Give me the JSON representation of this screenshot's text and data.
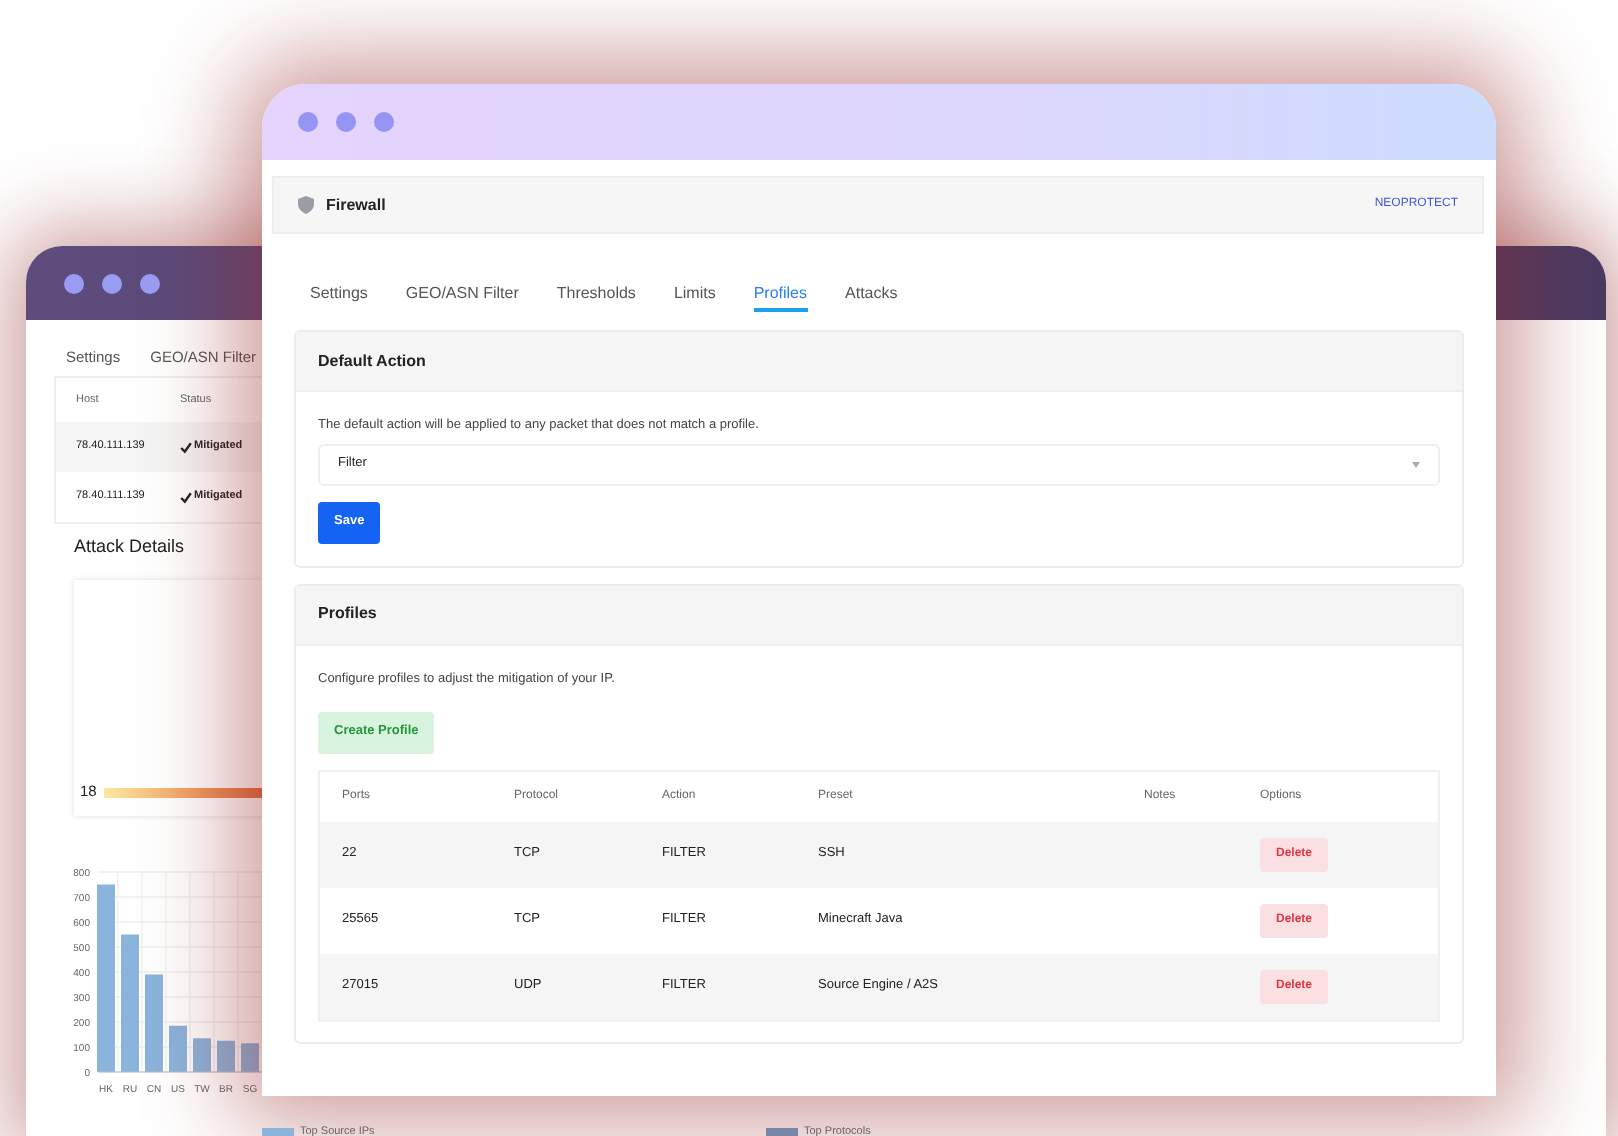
{
  "back_window": {
    "tabs": [
      {
        "label": "Settings",
        "selected": false
      },
      {
        "label": "GEO/ASN Filter",
        "selected": false
      }
    ],
    "attacks_table": {
      "columns": [
        "Host",
        "Status"
      ],
      "rows": [
        {
          "host": "78.40.111.139",
          "status": "Mitigated"
        },
        {
          "host": "78.40.111.139",
          "status": "Mitigated"
        }
      ]
    },
    "attack_details": {
      "title": "Attack Details",
      "scale_label": "18",
      "chart_data": {
        "type": "bar",
        "grid": true,
        "categories": [
          "HK",
          "RU",
          "CN",
          "US",
          "TW",
          "BR",
          "SG"
        ],
        "series": [
          {
            "name": "Top Source IPs",
            "color": "#8ab4dc",
            "values": [
              750,
              550,
              390,
              185,
              135,
              125,
              115
            ]
          }
        ],
        "ylim": [
          0,
          800
        ],
        "yticks": [
          0,
          100,
          200,
          300,
          400,
          500,
          600,
          700,
          800
        ]
      }
    },
    "legends": [
      {
        "label": "Top Protocols",
        "color": "#7a86a8"
      }
    ]
  },
  "front_window": {
    "header": {
      "title": "Firewall",
      "brand": "NEOPROTECT"
    },
    "tabs": [
      {
        "label": "Settings",
        "selected": false
      },
      {
        "label": "GEO/ASN Filter",
        "selected": false
      },
      {
        "label": "Thresholds",
        "selected": false
      },
      {
        "label": "Limits",
        "selected": false
      },
      {
        "label": "Profiles",
        "selected": true
      },
      {
        "label": "Attacks",
        "selected": false
      }
    ],
    "default_action": {
      "title": "Default Action",
      "description": "The default action will be applied to any packet that does not match a profile.",
      "value": "Filter",
      "button": "Save"
    },
    "profiles": {
      "title": "Profiles",
      "description": "Configure profiles to adjust the mitigation of your IP.",
      "button": "Create Profile",
      "columns": [
        "Ports",
        "Protocol",
        "Action",
        "Preset",
        "Notes",
        "Options"
      ],
      "rows": [
        {
          "ports": "22",
          "protocol": "TCP",
          "action": "FILTER",
          "preset": "SSH",
          "option": "Delete"
        },
        {
          "ports": "25565",
          "protocol": "TCP",
          "action": "FILTER",
          "preset": "Minecraft Java",
          "option": "Delete"
        },
        {
          "ports": "27015",
          "protocol": "UDP",
          "action": "FILTER",
          "preset": "Source Engine / A2S",
          "option": "Delete"
        }
      ]
    }
  }
}
